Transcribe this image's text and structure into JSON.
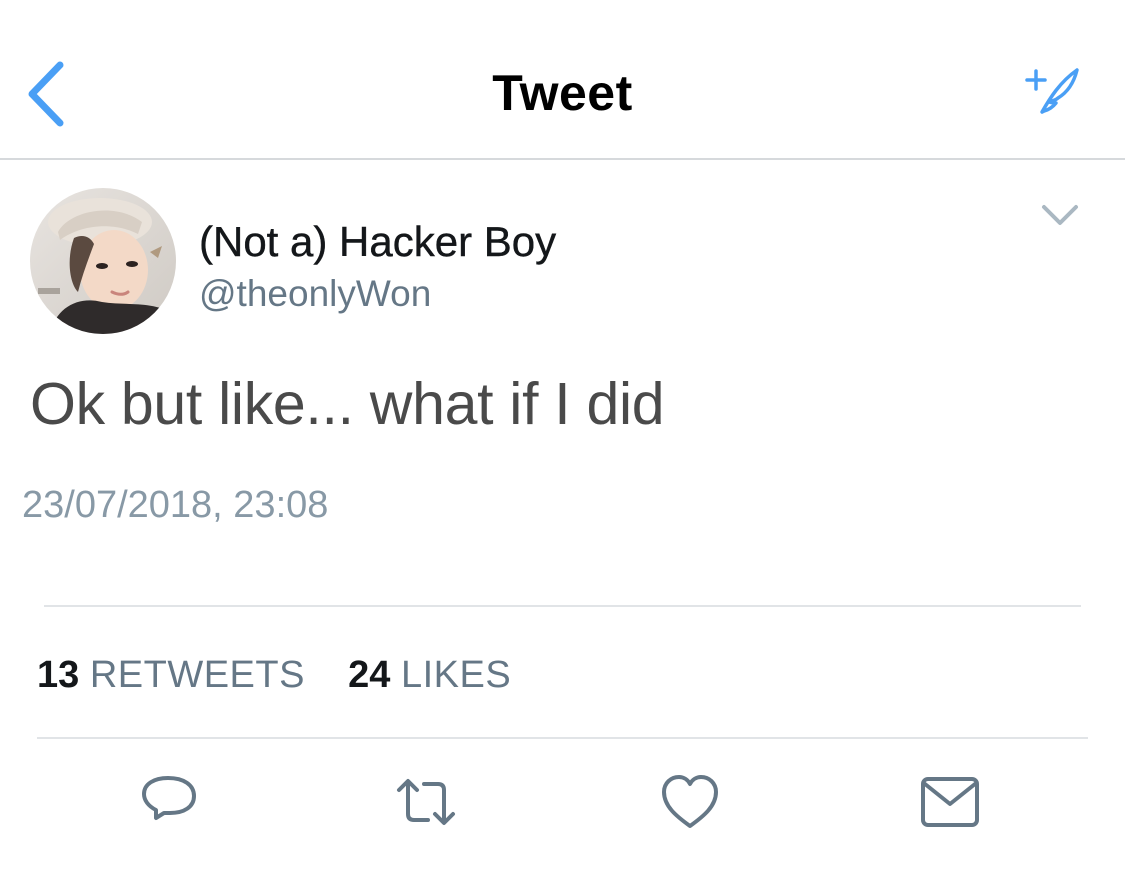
{
  "nav": {
    "title": "Tweet",
    "back_icon": "chevron-left-icon",
    "compose_icon": "compose-tweet-icon",
    "accent_color": "#4a9ff5"
  },
  "tweet": {
    "display_name": "(Not a) Hacker Boy",
    "handle": "@theonlyWon",
    "text": "Ok but like... what if I did",
    "timestamp": "23/07/2018, 23:08",
    "menu_icon": "chevron-down-icon"
  },
  "stats": {
    "retweets_count": "13",
    "retweets_label": "RETWEETS",
    "likes_count": "24",
    "likes_label": "LIKES"
  },
  "actions": [
    {
      "name": "reply",
      "icon": "reply-icon"
    },
    {
      "name": "retweet",
      "icon": "retweet-icon"
    },
    {
      "name": "like",
      "icon": "heart-icon"
    },
    {
      "name": "share",
      "icon": "envelope-icon"
    }
  ],
  "colors": {
    "text_primary": "#14171a",
    "text_secondary": "#657786",
    "icon_gray": "#657786",
    "divider": "#e1e4e7"
  }
}
